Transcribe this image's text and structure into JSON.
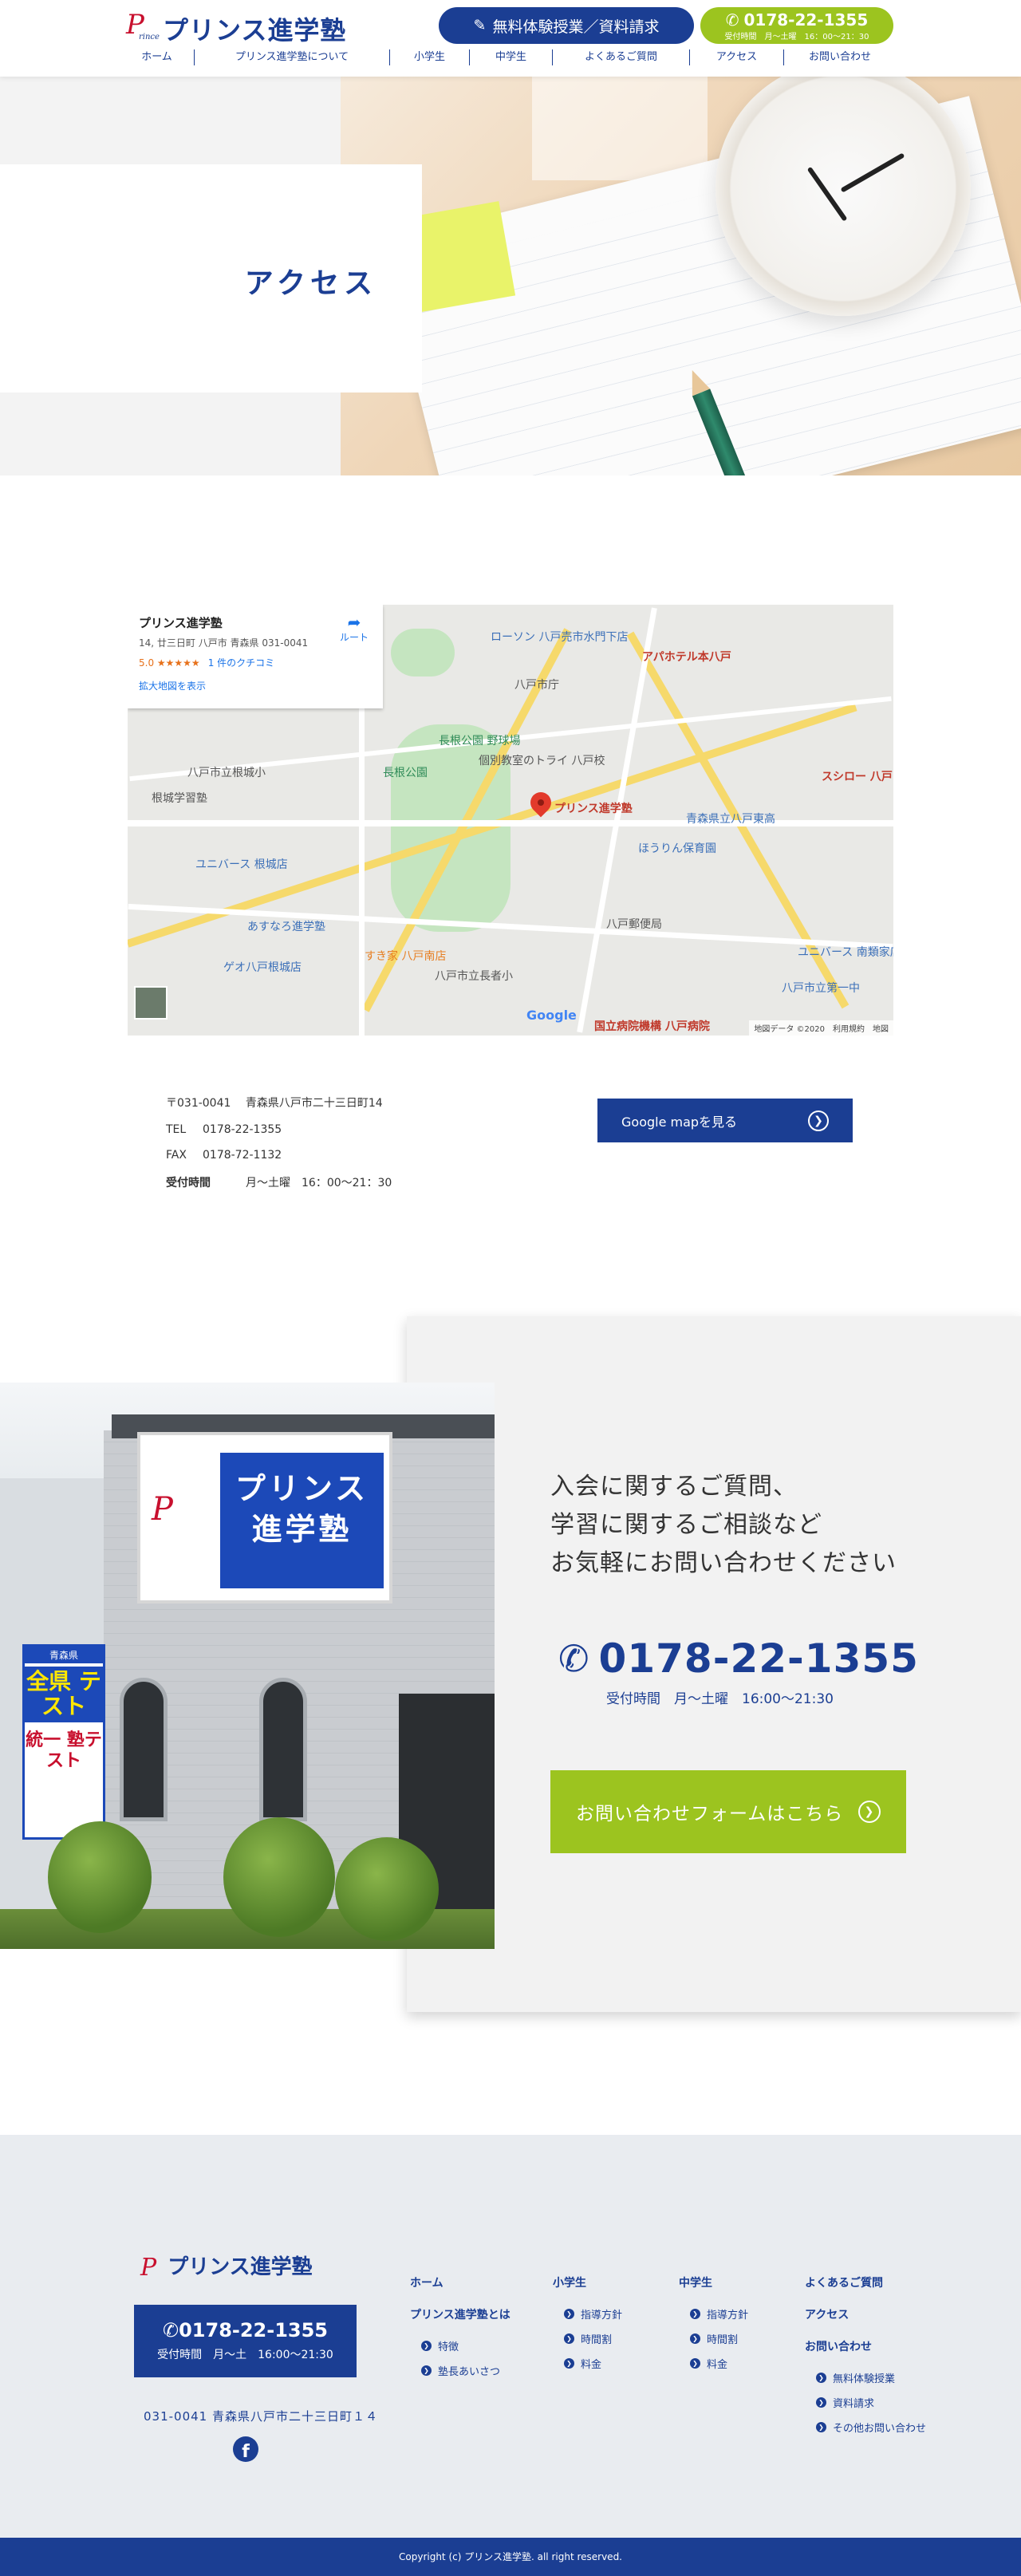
{
  "header": {
    "logo_text": "プリンス進学塾",
    "logo_mark": "P",
    "logo_mark_sub": "rince",
    "trial_button": "無料体験授業／資料請求",
    "phone": "0178-22-1355",
    "phone_hours": "受付時間　月〜土曜　16：00〜21：30",
    "nav": [
      "ホーム",
      "プリンス進学塾について",
      "小学生",
      "中学生",
      "よくあるご質問",
      "アクセス",
      "お問い合わせ"
    ]
  },
  "hero": {
    "title": "アクセス"
  },
  "map": {
    "card_name": "プリンス進学塾",
    "card_address": "14, 廿三日町 八戸市 青森県 031-0041",
    "card_rating": "5.0 ★★★★★",
    "card_reviews": "1 件のクチコミ",
    "card_larger": "拡大地図を表示",
    "card_route": "ルート",
    "pin_label": "プリンス進学塾",
    "labels": [
      "ローソン 八戸売市水門下店",
      "アパホテル本八戸",
      "八戸市庁",
      "根城学習塾",
      "長根公園",
      "長根公園 野球場",
      "個別教室のトライ 八戸校",
      "あすなろ進学塾",
      "ユニバース 根城店",
      "すき家 八戸南店",
      "ゲオ八戸根城店",
      "八戸市立長者小",
      "八戸市立根城小",
      "八戸郵便局",
      "国立病院機構 八戸病院",
      "ほうりん保育園",
      "青森県立八戸東高",
      "八戸市立第一中",
      "ユニバース 南類家店",
      "スシロー 八戸"
    ],
    "google": "Google",
    "footer": "地図データ ©2020　利用規約　地図"
  },
  "address": {
    "zip_line": "〒031-0041　 青森県八戸市二十三日町14",
    "tel_label": "TEL",
    "tel": "0178-22-1355",
    "fax_label": "FAX",
    "fax": "0178-72-1132",
    "hours_label": "受付時間",
    "hours": "月〜土曜　16：00〜21：30",
    "gmap_button": "Google mapを見る"
  },
  "contact": {
    "message_lines": [
      "入会に関するご質問、",
      "学習に関するご相談など",
      "お気軽にお問い合わせください"
    ],
    "phone": "0178-22-1355",
    "hours": "受付時間　月〜土曜　16:00〜21:30",
    "form_button": "お問い合わせフォームはこちら",
    "photo_sign": "プリンス 進学塾",
    "banner_top": "青森県",
    "banner_main": "全県 テスト",
    "banner_sub": "統一 塾テスト"
  },
  "footer": {
    "logo_text": "プリンス進学塾",
    "phone": "0178-22-1355",
    "hours": "受付時間　月〜土　16:00〜21:30",
    "address": "031-0041 青森県八戸市二十三日町１４",
    "col1": {
      "items": [
        "ホーム",
        "プリンス進学塾とは"
      ],
      "subs": [
        "特徴",
        "塾長あいさつ"
      ]
    },
    "col2": {
      "head": "小学生",
      "subs": [
        "指導方針",
        "時間割",
        "料金"
      ]
    },
    "col3": {
      "head": "中学生",
      "subs": [
        "指導方針",
        "時間割",
        "料金"
      ]
    },
    "col4": {
      "items": [
        "よくあるご質問",
        "アクセス",
        "お問い合わせ"
      ],
      "subs": [
        "無料体験授業",
        "資料請求",
        "その他お問い合わせ"
      ]
    },
    "copyright": "Copyright (c) プリンス進学塾. all right reserved."
  },
  "colors": {
    "brand_blue": "#1b3e93",
    "accent_green": "#9cc41f",
    "logo_red": "#c8102e"
  }
}
